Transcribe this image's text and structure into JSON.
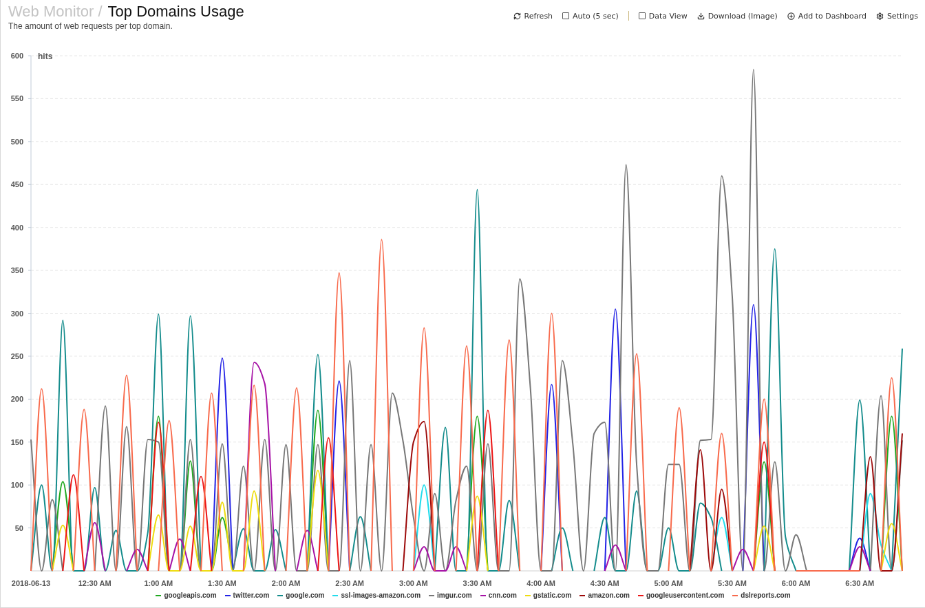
{
  "header": {
    "breadcrumb": "Web Monitor /",
    "title": "Top Domains Usage",
    "subtitle": "The amount of web requests per top domain."
  },
  "toolbar": [
    {
      "kind": "refresh",
      "label": "Refresh"
    },
    {
      "kind": "checkbox",
      "label": "Auto (5 sec)",
      "checked": false
    },
    {
      "kind": "checkbox",
      "label": "Data View",
      "checked": false
    },
    {
      "kind": "download",
      "label": "Download (Image)"
    },
    {
      "kind": "add",
      "label": "Add to Dashboard"
    },
    {
      "kind": "settings",
      "label": "Settings"
    }
  ],
  "chart": {
    "chart_data": {
      "type": "line",
      "ylabel": "hits",
      "grid": true,
      "xlim": [
        0,
        410
      ],
      "ylim": [
        0,
        600
      ],
      "x": [
        0,
        5,
        10,
        15,
        20,
        25,
        30,
        35,
        40,
        45,
        50,
        55,
        60,
        65,
        70,
        75,
        80,
        85,
        90,
        95,
        100,
        105,
        110,
        115,
        120,
        125,
        130,
        135,
        140,
        145,
        150,
        155,
        160,
        165,
        170,
        175,
        180,
        185,
        190,
        195,
        200,
        205,
        210,
        215,
        220,
        225,
        230,
        235,
        240,
        245,
        250,
        255,
        260,
        265,
        270,
        275,
        280,
        285,
        290,
        295,
        300,
        305,
        310,
        315,
        320,
        325,
        330,
        335,
        340,
        345,
        350,
        355,
        360,
        365,
        370,
        375,
        380,
        385,
        390,
        395,
        400,
        405,
        410
      ],
      "xticks": [
        {
          "value": 0,
          "label": "2018-06-13"
        },
        {
          "value": 30,
          "label": "12:30 AM"
        },
        {
          "value": 60,
          "label": "1:00 AM"
        },
        {
          "value": 90,
          "label": "1:30 AM"
        },
        {
          "value": 120,
          "label": "2:00 AM"
        },
        {
          "value": 150,
          "label": "2:30 AM"
        },
        {
          "value": 180,
          "label": "3:00 AM"
        },
        {
          "value": 210,
          "label": "3:30 AM"
        },
        {
          "value": 240,
          "label": "4:00 AM"
        },
        {
          "value": 270,
          "label": "4:30 AM"
        },
        {
          "value": 300,
          "label": "5:00 AM"
        },
        {
          "value": 330,
          "label": "5:30 AM"
        },
        {
          "value": 360,
          "label": "6:00 AM"
        },
        {
          "value": 390,
          "label": "6:30 AM"
        }
      ],
      "yticks": [
        50,
        100,
        150,
        200,
        250,
        300,
        350,
        400,
        450,
        500,
        550,
        600
      ],
      "series": [
        {
          "name": "googleapis.com",
          "color": "#1fa81f",
          "values": [
            null,
            null,
            0,
            104,
            0,
            null,
            null,
            null,
            null,
            null,
            null,
            0,
            180,
            0,
            0,
            128,
            0,
            0,
            62,
            0,
            null,
            null,
            null,
            null,
            null,
            null,
            0,
            187,
            0,
            null,
            null,
            null,
            null,
            null,
            null,
            null,
            null,
            null,
            null,
            null,
            null,
            0,
            180,
            0,
            null,
            null,
            null,
            null,
            null,
            null,
            null,
            null,
            null,
            null,
            null,
            null,
            null,
            null,
            null,
            null,
            null,
            null,
            null,
            null,
            null,
            null,
            null,
            null,
            0,
            127,
            0,
            null,
            null,
            null,
            null,
            null,
            null,
            null,
            null,
            null,
            0,
            180,
            0
          ]
        },
        {
          "name": "twitter.com",
          "color": "#2323e6",
          "values": [
            null,
            null,
            null,
            null,
            null,
            null,
            null,
            null,
            null,
            null,
            null,
            null,
            null,
            null,
            null,
            null,
            null,
            0,
            248,
            0,
            null,
            null,
            null,
            null,
            null,
            null,
            null,
            null,
            0,
            221,
            0,
            null,
            null,
            null,
            null,
            null,
            null,
            null,
            null,
            null,
            null,
            null,
            null,
            null,
            null,
            null,
            null,
            null,
            0,
            217,
            0,
            null,
            null,
            null,
            0,
            305,
            0,
            null,
            null,
            null,
            null,
            null,
            null,
            null,
            null,
            null,
            null,
            0,
            310,
            0,
            null,
            null,
            null,
            null,
            null,
            null,
            null,
            0,
            38,
            0,
            null,
            null,
            null
          ]
        },
        {
          "name": "google.com",
          "color": "#148c8c",
          "values": [
            0,
            100,
            0,
            292,
            0,
            0,
            97,
            0,
            47,
            0,
            0,
            45,
            299,
            0,
            0,
            297,
            0,
            null,
            null,
            0,
            49,
            0,
            0,
            48,
            0,
            null,
            0,
            252,
            0,
            null,
            0,
            63,
            0,
            null,
            null,
            null,
            null,
            null,
            0,
            167,
            0,
            0,
            444,
            0,
            0,
            82,
            0,
            null,
            null,
            0,
            50,
            0,
            null,
            0,
            62,
            0,
            0,
            93,
            0,
            0,
            50,
            0,
            0,
            79,
            62,
            0,
            null,
            null,
            null,
            0,
            375,
            40,
            0,
            null,
            null,
            null,
            null,
            0,
            199,
            0,
            null,
            0,
            259
          ]
        },
        {
          "name": "ssl-images-amazon.com",
          "color": "#22dcec",
          "values": [
            null,
            null,
            null,
            null,
            null,
            null,
            null,
            null,
            null,
            null,
            null,
            null,
            null,
            null,
            null,
            null,
            null,
            null,
            null,
            null,
            null,
            null,
            null,
            null,
            null,
            null,
            null,
            null,
            null,
            null,
            null,
            null,
            null,
            null,
            null,
            null,
            0,
            100,
            0,
            null,
            null,
            null,
            null,
            null,
            null,
            null,
            null,
            null,
            null,
            null,
            null,
            null,
            null,
            null,
            null,
            null,
            null,
            null,
            null,
            null,
            null,
            null,
            null,
            null,
            0,
            62,
            0,
            null,
            null,
            null,
            null,
            null,
            null,
            null,
            null,
            null,
            null,
            null,
            0,
            90,
            30,
            0,
            null
          ]
        },
        {
          "name": "imgur.com",
          "color": "#777777",
          "values": [
            153,
            0,
            83,
            0,
            null,
            null,
            0,
            192,
            0,
            168,
            0,
            153,
            150,
            0,
            0,
            153,
            0,
            0,
            148,
            0,
            122,
            0,
            153,
            0,
            147,
            0,
            0,
            147,
            0,
            0,
            245,
            0,
            147,
            0,
            207,
            152,
            62,
            0,
            90,
            0,
            82,
            122,
            0,
            148,
            0,
            0,
            340,
            213,
            0,
            0,
            245,
            147,
            0,
            160,
            173,
            0,
            473,
            124,
            0,
            0,
            124,
            124,
            0,
            152,
            153,
            460,
            319,
            0,
            584,
            0,
            127,
            0,
            42,
            0,
            null,
            null,
            null,
            null,
            null,
            0,
            204,
            0,
            152
          ]
        },
        {
          "name": "cnn.com",
          "color": "#a612a6",
          "values": [
            null,
            null,
            null,
            null,
            null,
            0,
            56,
            0,
            null,
            0,
            25,
            0,
            null,
            0,
            37,
            0,
            null,
            null,
            null,
            null,
            0,
            243,
            218,
            0,
            null,
            0,
            47,
            0,
            null,
            null,
            null,
            null,
            null,
            null,
            null,
            null,
            0,
            28,
            0,
            0,
            28,
            0,
            null,
            null,
            null,
            null,
            null,
            null,
            null,
            null,
            null,
            null,
            null,
            null,
            0,
            30,
            0,
            null,
            null,
            null,
            null,
            null,
            null,
            null,
            null,
            null,
            0,
            25,
            0,
            null,
            null,
            null,
            null,
            null,
            null,
            null,
            null,
            0,
            28,
            0,
            null,
            null,
            null
          ]
        },
        {
          "name": "gstatic.com",
          "color": "#eedc10",
          "values": [
            null,
            null,
            0,
            53,
            0,
            null,
            null,
            null,
            null,
            null,
            null,
            0,
            65,
            0,
            0,
            52,
            0,
            0,
            80,
            0,
            0,
            93,
            0,
            null,
            null,
            null,
            0,
            117,
            0,
            null,
            null,
            null,
            null,
            null,
            null,
            null,
            null,
            null,
            null,
            null,
            null,
            0,
            87,
            0,
            null,
            null,
            null,
            null,
            null,
            null,
            null,
            null,
            null,
            null,
            null,
            null,
            null,
            null,
            null,
            null,
            null,
            null,
            null,
            null,
            null,
            null,
            null,
            null,
            0,
            52,
            0,
            null,
            null,
            null,
            null,
            null,
            null,
            null,
            null,
            null,
            0,
            55,
            0
          ]
        },
        {
          "name": "amazon.com",
          "color": "#9c0a0a",
          "values": [
            null,
            null,
            null,
            null,
            null,
            null,
            null,
            null,
            null,
            null,
            null,
            null,
            null,
            null,
            null,
            null,
            null,
            null,
            null,
            null,
            null,
            null,
            null,
            null,
            null,
            null,
            null,
            null,
            null,
            null,
            null,
            null,
            null,
            null,
            null,
            0,
            150,
            174,
            0,
            null,
            null,
            null,
            null,
            null,
            null,
            null,
            null,
            null,
            null,
            null,
            null,
            null,
            null,
            null,
            null,
            null,
            null,
            null,
            null,
            null,
            null,
            null,
            0,
            141,
            0,
            95,
            0,
            null,
            null,
            null,
            null,
            null,
            null,
            null,
            null,
            null,
            null,
            null,
            0,
            133,
            0,
            0,
            160
          ]
        },
        {
          "name": "googleusercontent.com",
          "color": "#ec1616",
          "values": [
            null,
            null,
            null,
            0,
            112,
            0,
            null,
            null,
            null,
            null,
            null,
            0,
            173,
            0,
            null,
            0,
            110,
            0,
            null,
            null,
            null,
            null,
            null,
            null,
            null,
            null,
            null,
            0,
            155,
            0,
            null,
            null,
            null,
            null,
            null,
            null,
            null,
            null,
            null,
            null,
            null,
            null,
            0,
            187,
            0,
            null,
            null,
            null,
            null,
            null,
            null,
            null,
            null,
            null,
            null,
            null,
            null,
            null,
            null,
            null,
            null,
            null,
            null,
            null,
            null,
            null,
            null,
            null,
            0,
            150,
            0,
            null,
            null,
            null,
            null,
            null,
            null,
            null,
            null,
            null,
            null,
            null,
            null
          ]
        },
        {
          "name": "dslreports.com",
          "color": "#f86a4c",
          "values": [
            0,
            212,
            0,
            null,
            0,
            188,
            0,
            null,
            0,
            228,
            0,
            null,
            0,
            175,
            0,
            null,
            0,
            207,
            0,
            null,
            0,
            216,
            0,
            null,
            0,
            213,
            0,
            null,
            0,
            347,
            0,
            null,
            0,
            386,
            0,
            null,
            0,
            283,
            0,
            null,
            0,
            262,
            0,
            null,
            0,
            269,
            0,
            null,
            0,
            300,
            0,
            null,
            null,
            null,
            null,
            null,
            0,
            253,
            0,
            null,
            0,
            190,
            0,
            null,
            0,
            160,
            0,
            null,
            0,
            200,
            0,
            null,
            0,
            0,
            0,
            0,
            0,
            0,
            0,
            null,
            0,
            225,
            0
          ]
        }
      ]
    }
  }
}
